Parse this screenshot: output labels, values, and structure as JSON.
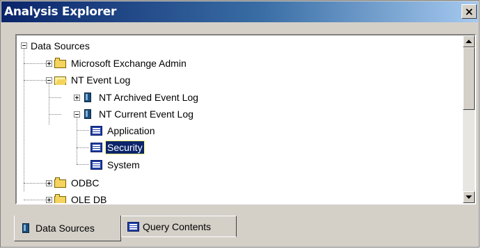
{
  "window": {
    "title": "Analysis Explorer",
    "close_label": "x"
  },
  "tree": {
    "items": [
      {
        "label": "Data Sources",
        "icon": "none"
      },
      {
        "label": "Microsoft Exchange Admin",
        "icon": "folder-icon"
      },
      {
        "label": "NT Event Log",
        "icon": "folder-open-icon"
      },
      {
        "label": "NT Archived Event Log",
        "icon": "cube-icon"
      },
      {
        "label": "NT Current Event Log",
        "icon": "cube-icon"
      },
      {
        "label": "Application",
        "icon": "dimension-icon"
      },
      {
        "label": "Security",
        "icon": "dimension-icon",
        "selected": true
      },
      {
        "label": "System",
        "icon": "dimension-icon"
      },
      {
        "label": "ODBC",
        "icon": "folder-icon"
      },
      {
        "label": "OLE DB",
        "icon": "folder-icon"
      }
    ]
  },
  "tabs": [
    {
      "label": "Data Sources",
      "icon": "cube-icon",
      "active": true
    },
    {
      "label": "Query Contents",
      "icon": "dimension-icon",
      "active": false
    }
  ],
  "colors": {
    "title_gradient_start": "#0a246a",
    "title_gradient_end": "#a6caf0",
    "selection": "#0a246a",
    "chrome": "#d4d0c8"
  }
}
